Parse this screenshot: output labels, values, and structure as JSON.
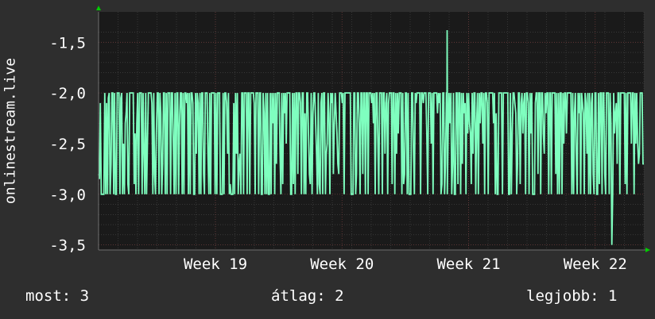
{
  "chart_data": {
    "type": "line",
    "ylabel": "onlinestream.live",
    "ylim": [
      -3.55,
      -1.2
    ],
    "yticks": [
      {
        "value": -1.5,
        "label": "-1,5"
      },
      {
        "value": -2.0,
        "label": "-2,0"
      },
      {
        "value": -2.5,
        "label": "-2,5"
      },
      {
        "value": -3.0,
        "label": "-3,0"
      },
      {
        "value": -3.5,
        "label": "-3,5"
      }
    ],
    "xlim": [
      0,
      28
    ],
    "xticks": [
      {
        "value": 6,
        "label": "Week 19"
      },
      {
        "value": 12.5,
        "label": "Week 20"
      },
      {
        "value": 19,
        "label": "Week 21"
      },
      {
        "value": 25.5,
        "label": "Week 22"
      }
    ],
    "grid": true,
    "colors": {
      "line": "#7fffbf",
      "background": "#2e2e2e",
      "plot": "#1a1a1a",
      "grid": "#4a4a4a",
      "grid_major": "#6b3a3a",
      "arrow": "#00cc00"
    },
    "series": [
      {
        "values": [
          -2.8,
          -2.85,
          -2.1,
          -3.0,
          -3.0,
          -3.0,
          -3.0,
          -2.0,
          -3.0,
          -2.1,
          -3.0,
          -2.05,
          -2.0,
          -3.0,
          -2.7,
          -2.0,
          -2.0,
          -3.0,
          -2.0,
          -3.0,
          -3.0,
          -2.0,
          -2.0,
          -2.0,
          -3.0,
          -2.05,
          -2.0,
          -3.0,
          -2.5,
          -3.0,
          -2.3,
          -2.2,
          -2.0,
          -2.9,
          -3.0,
          -2.0,
          -2.0,
          -2.0,
          -2.0,
          -2.0,
          -2.9,
          -2.4,
          -3.0,
          -2.3,
          -2.0,
          -3.0,
          -2.0,
          -2.0,
          -2.0,
          -3.0,
          -2.0,
          -2.6,
          -3.0,
          -2.0,
          -3.0,
          -2.5,
          -2.0,
          -2.0,
          -2.0,
          -2.0,
          -2.1,
          -3.0,
          -2.0,
          -2.8,
          -3.0,
          -2.4,
          -2.0,
          -2.0,
          -3.0,
          -2.0,
          -2.2,
          -3.0,
          -2.7,
          -2.0,
          -2.0,
          -3.0,
          -2.0,
          -3.0,
          -2.0,
          -2.0,
          -2.0,
          -3.0,
          -2.0,
          -2.0,
          -2.5,
          -3.0,
          -2.0,
          -3.0,
          -2.0,
          -2.0,
          -3.0,
          -2.3,
          -2.0,
          -2.0,
          -3.0,
          -2.0,
          -3.0,
          -2.0,
          -2.0,
          -2.1,
          -2.0,
          -3.0,
          -2.0,
          -3.0,
          -2.0,
          -2.0,
          -2.1,
          -3.0,
          -3.0,
          -2.0,
          -2.6,
          -2.0,
          -2.1,
          -3.0,
          -2.0,
          -3.0,
          -2.0,
          -2.0,
          -2.8,
          -3.0,
          -2.0,
          -2.0,
          -2.0,
          -2.6,
          -3.0,
          -2.0,
          -3.0,
          -2.0,
          -2.0,
          -2.0,
          -2.0,
          -3.0,
          -2.0,
          -3.0,
          -2.0,
          -2.0,
          -2.0,
          -3.0,
          -3.0,
          -3.0,
          -2.0,
          -3.0,
          -2.0,
          -2.0,
          -2.1,
          -2.6,
          -2.0,
          -3.0,
          -2.9,
          -3.0,
          -3.0,
          -3.0,
          -2.1,
          -3.0,
          -2.0,
          -2.6,
          -2.0,
          -3.0,
          -2.7,
          -2.6,
          -3.0,
          -2.0,
          -2.0,
          -3.0,
          -2.0,
          -2.0,
          -2.0,
          -3.0,
          -2.0,
          -2.0,
          -3.0,
          -2.0,
          -2.0,
          -2.0,
          -2.0,
          -2.1,
          -3.0,
          -2.0,
          -2.0,
          -2.0,
          -3.0,
          -2.0,
          -2.0,
          -3.0,
          -3.0,
          -2.0,
          -2.2,
          -3.0,
          -2.0,
          -3.0,
          -2.0,
          -3.0,
          -3.0,
          -2.0,
          -3.0,
          -2.0,
          -2.3,
          -2.0,
          -3.0,
          -2.0,
          -2.7,
          -2.0,
          -2.0,
          -2.0,
          -2.6,
          -3.0,
          -2.0,
          -2.9,
          -2.0,
          -2.2,
          -2.0,
          -2.5,
          -2.0,
          -2.0,
          -2.0,
          -2.0,
          -3.0,
          -3.0,
          -2.0,
          -2.9,
          -2.0,
          -3.0,
          -2.0,
          -2.0,
          -2.8,
          -2.0,
          -2.0,
          -2.1,
          -3.0,
          -2.0,
          -2.0,
          -3.0,
          -2.2,
          -3.0,
          -2.0,
          -2.0,
          -2.4,
          -2.8,
          -2.9,
          -2.0,
          -3.0,
          -2.2,
          -2.0,
          -2.0,
          -2.3,
          -2.6,
          -3.0,
          -2.0,
          -2.9,
          -3.0,
          -2.1,
          -2.0,
          -3.0,
          -2.0,
          -2.0,
          -3.0,
          -2.6,
          -2.5,
          -2.0,
          -2.2,
          -3.0,
          -2.0,
          -2.1,
          -2.0,
          -2.8,
          -2.3,
          -2.0,
          -2.2,
          -2.4,
          -2.7,
          -2.8,
          -2.0,
          -2.0,
          -2.0,
          -2.1,
          -2.0,
          -3.0,
          -2.0,
          -2.0,
          -2.0,
          -2.0,
          -2.0,
          -2.0,
          -2.0,
          -3.0,
          -3.0,
          -3.0,
          -2.0,
          -2.0,
          -3.0,
          -2.8,
          -2.0,
          -2.0,
          -2.3,
          -3.0,
          -2.0,
          -2.0,
          -2.8,
          -2.0,
          -2.0,
          -3.0,
          -2.0,
          -2.0,
          -3.0,
          -2.0,
          -2.0,
          -2.0,
          -2.1,
          -2.0,
          -2.3,
          -2.0,
          -3.0,
          -2.0,
          -2.0,
          -2.5,
          -3.0,
          -2.0,
          -2.0,
          -2.0,
          -3.0,
          -2.0,
          -2.0,
          -2.6,
          -2.1,
          -2.0,
          -3.0,
          -2.1,
          -2.0,
          -2.0,
          -2.0,
          -2.9,
          -2.0,
          -2.0,
          -3.0,
          -2.0,
          -2.6,
          -2.0,
          -2.4,
          -2.0,
          -2.0,
          -2.0,
          -3.0,
          -2.0,
          -2.9,
          -2.8,
          -2.0,
          -2.0,
          -3.0,
          -2.0,
          -3.0,
          -3.0,
          -3.0,
          -2.0,
          -2.0,
          -2.6,
          -3.0,
          -2.0,
          -2.1,
          -2.0,
          -2.0,
          -2.0,
          -2.0,
          -3.0,
          -2.0,
          -2.0,
          -2.1,
          -2.0,
          -2.0,
          -2.0,
          -2.4,
          -3.0,
          -2.0,
          -2.0,
          -2.0,
          -2.5,
          -2.0,
          -3.0,
          -2.0,
          -2.0,
          -2.0,
          -2.0,
          -2.2,
          -2.0,
          -2.1,
          -2.0,
          -3.0,
          -2.9,
          -2.0,
          -2.0,
          -3.0,
          -2.7,
          -2.0,
          -3.0,
          -2.4,
          -2.0,
          -2.3,
          -2.0,
          -3.0,
          -2.7,
          -2.0,
          -3.0,
          -3.0,
          -2.0,
          -2.0,
          -2.9,
          -2.0,
          -2.0,
          -3.0,
          -2.0,
          -2.7,
          -2.0,
          -2.2,
          -2.1,
          -3.0,
          -2.0,
          -2.4,
          -2.0,
          -2.3,
          -2.4,
          -2.9,
          -2.0,
          -2.6,
          -2.0,
          -2.0,
          -3.0,
          -2.3,
          -2.0,
          -3.0,
          -2.0,
          -2.3,
          -2.0,
          -2.0,
          -2.5,
          -2.0,
          -3.0,
          -2.0,
          -2.0,
          -2.1,
          -3.0,
          -2.0,
          -2.0,
          -2.0,
          -2.0,
          -2.0,
          -2.3,
          -2.0,
          -3.0,
          -2.2,
          -3.0,
          -3.0,
          -2.0,
          -2.0,
          -2.0,
          -2.0,
          -3.0,
          -2.0,
          -2.0,
          -2.0,
          -2.0,
          -2.0,
          -2.0,
          -3.0,
          -3.0,
          -2.0,
          -3.0,
          -2.4,
          -2.0,
          -2.0,
          -2.1,
          -2.2,
          -3.0,
          -2.7,
          -2.0,
          -2.0,
          -2.9,
          -2.1,
          -2.0,
          -2.4,
          -2.1,
          -2.0,
          -3.0,
          -2.0,
          -2.0,
          -2.1,
          -3.0,
          -2.0,
          -2.4,
          -2.0,
          -3.0,
          -3.0,
          -3.0,
          -2.1,
          -2.0,
          -2.0,
          -2.8,
          -2.0,
          -2.0,
          -3.0,
          -2.0,
          -2.0,
          -2.4,
          -2.6,
          -2.0,
          -2.2,
          -2.0,
          -2.0,
          -3.0,
          -2.0,
          -2.0,
          -3.0,
          -2.0,
          -2.0,
          -2.0,
          -2.0,
          -2.8,
          -2.0,
          -3.0,
          -2.0,
          -3.0,
          -2.0,
          -2.0,
          -3.0,
          -2.0,
          -2.5,
          -2.0,
          -2.0,
          -2.4,
          -2.0,
          -2.0,
          -2.0,
          -2.0,
          -2.0,
          -3.0,
          -2.0,
          -3.0,
          -2.2,
          -2.0,
          -2.6,
          -3.0,
          -2.0,
          -2.2,
          -2.0,
          -3.0,
          -2.0,
          -2.1,
          -2.2,
          -3.0,
          -2.0,
          -2.1,
          -2.6,
          -2.0,
          -3.0,
          -2.0,
          -3.0,
          -2.1,
          -2.0,
          -2.8,
          -3.0,
          -2.0,
          -2.0,
          -3.0,
          -3.0,
          -2.0,
          -2.9,
          -2.0,
          -2.0,
          -3.0,
          -2.0,
          -2.0,
          -2.8,
          -3.0,
          -2.0,
          -2.0,
          -2.0,
          -3.0,
          -2.0,
          -2.3,
          -3.5,
          -3.0,
          -2.0,
          -2.4,
          -2.2,
          -2.1,
          -2.7,
          -2.0,
          -2.0,
          -3.0,
          -2.0,
          -2.0,
          -2.0,
          -2.0,
          -2.0,
          -2.9,
          -2.0,
          -3.0,
          -2.0,
          -2.0,
          -2.0,
          -2.0,
          -2.5,
          -2.0,
          -2.0,
          -3.0,
          -2.0,
          -2.5,
          -2.0,
          -2.5,
          -2.7,
          -2.6,
          -2.0,
          -2.0,
          -2.0,
          -2.7,
          -2.7
        ],
        "spike": {
          "x": 17.9,
          "value": -1.38
        }
      }
    ]
  },
  "legend": {
    "now": "most: 3",
    "avg": "átlag: 2",
    "best": "legjobb: 1"
  }
}
